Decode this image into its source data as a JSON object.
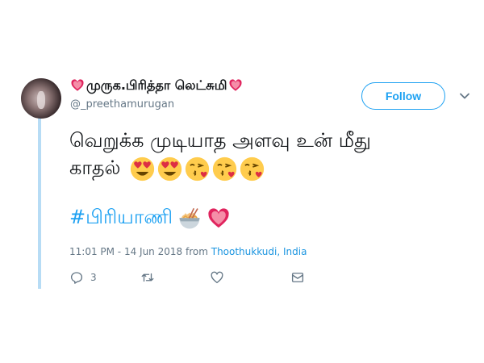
{
  "tweet": {
    "user": {
      "display_name": "முருக.பிரித்தா லெட்சுமி",
      "handle": "@_preethamurugan"
    },
    "follow_label": "Follow",
    "text": "வெறுக்க முடியாத அளவு உன் மீது காதல்",
    "hashtag": "#பிரியாணி",
    "timestamp": "11:01 PM - 14 Jun 2018",
    "from_label": "from",
    "location": "Thoothukkudi, India",
    "actions": {
      "reply_count": "3"
    },
    "icons": [
      "heart-emoji",
      "heart-eyes-emoji",
      "kissing-heart-emoji",
      "noodle-bowl-emoji",
      "reply-icon",
      "retweet-icon",
      "like-icon",
      "message-icon",
      "caret-icon"
    ],
    "colors": {
      "accent": "#1da1f2",
      "thread_line": "#b7dcf5",
      "muted": "#657786"
    }
  }
}
